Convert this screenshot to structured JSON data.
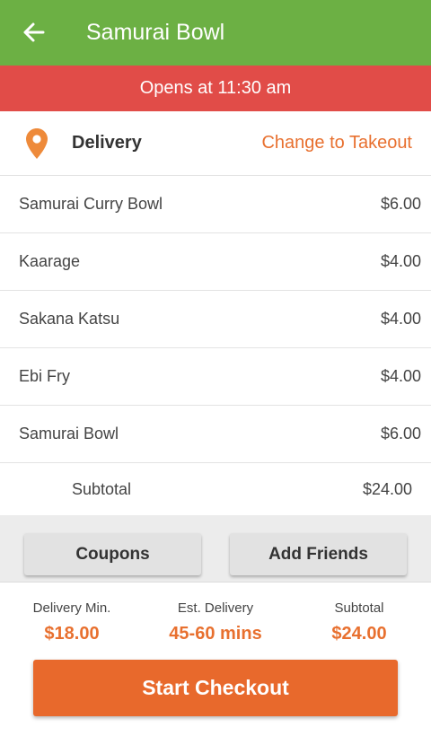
{
  "header": {
    "back_icon": "arrow-left-icon",
    "title": "Samurai Bowl",
    "background_color": "#6cb044"
  },
  "status_banner": {
    "text": "Opens at 11:30 am",
    "background_color": "#e14c48"
  },
  "order_mode": {
    "icon": "location-pin-icon",
    "label": "Delivery",
    "change_link": "Change to Takeout",
    "accent_color": "#e8702f"
  },
  "items": [
    {
      "name": "Samurai Curry Bowl",
      "price": "$6.00"
    },
    {
      "name": "Kaarage",
      "price": "$4.00"
    },
    {
      "name": "Sakana Katsu",
      "price": "$4.00"
    },
    {
      "name": "Ebi Fry",
      "price": "$4.00"
    },
    {
      "name": "Samurai Bowl",
      "price": "$6.00"
    }
  ],
  "subtotal_row": {
    "label": "Subtotal",
    "value": "$24.00"
  },
  "actions": {
    "coupons_label": "Coupons",
    "add_friends_label": "Add Friends"
  },
  "summary": {
    "delivery_min": {
      "label": "Delivery Min.",
      "value": "$18.00"
    },
    "est_delivery": {
      "label": "Est. Delivery",
      "value": "45-60 mins"
    },
    "subtotal": {
      "label": "Subtotal",
      "value": "$24.00"
    }
  },
  "checkout": {
    "label": "Start Checkout",
    "background_color": "#e8692c"
  }
}
